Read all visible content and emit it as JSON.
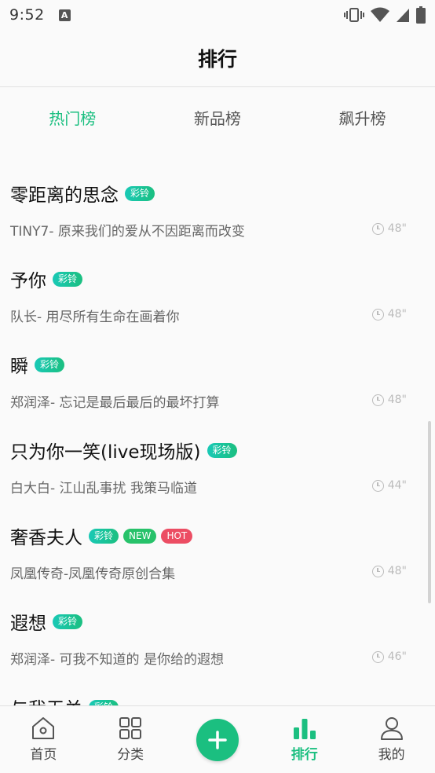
{
  "status": {
    "time": "9:52",
    "a_glyph": "A"
  },
  "header": {
    "title": "排行"
  },
  "tabs": [
    {
      "label": "热门榜",
      "active": true
    },
    {
      "label": "新品榜",
      "active": false
    },
    {
      "label": "飙升榜",
      "active": false
    }
  ],
  "songs": [
    {
      "title": "零距离的思念",
      "artist": "TINY7- 原来我们的爱从不因距离而改变",
      "duration": "48\"",
      "badges": [
        "彩铃"
      ]
    },
    {
      "title": "予你",
      "artist": "队长-  用尽所有生命在画着你",
      "duration": "48\"",
      "badges": [
        "彩铃"
      ]
    },
    {
      "title": "瞬",
      "artist": "郑润泽-  忘记是最后最后的最坏打算",
      "duration": "48\"",
      "badges": [
        "彩铃"
      ]
    },
    {
      "title": "只为你一笑(live现场版)",
      "artist": "白大白-  江山乱事扰 我策马临道",
      "duration": "44\"",
      "badges": [
        "彩铃"
      ]
    },
    {
      "title": "奢香夫人",
      "artist": "凤凰传奇-凤凰传奇原创合集",
      "duration": "48\"",
      "badges": [
        "彩铃",
        "NEW",
        "HOT"
      ]
    },
    {
      "title": "遐想",
      "artist": "郑润泽-  可我不知道的 是你给的遐想",
      "duration": "46\"",
      "badges": [
        "彩铃"
      ]
    },
    {
      "title": "与我无关",
      "artist": "",
      "duration": "",
      "badges": [
        "彩铃"
      ]
    }
  ],
  "bottom_nav": [
    {
      "label": "首页",
      "icon": "home-icon",
      "active": false
    },
    {
      "label": "分类",
      "icon": "grid-icon",
      "active": false
    },
    {
      "label": "",
      "icon": "plus-icon",
      "active": false
    },
    {
      "label": "排行",
      "icon": "chart-icon",
      "active": true
    },
    {
      "label": "我的",
      "icon": "user-icon",
      "active": false
    }
  ],
  "colors": {
    "accent": "#1bbf80",
    "hot": "#ec4d63",
    "new": "#27c26a"
  }
}
